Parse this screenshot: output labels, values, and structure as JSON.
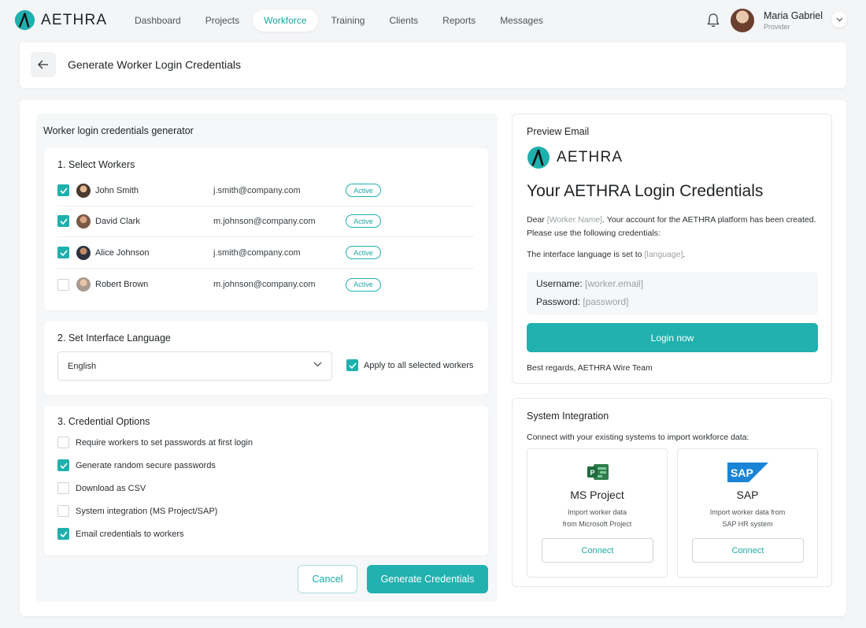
{
  "brand": {
    "name": "AETHRA"
  },
  "nav": {
    "items": [
      "Dashboard",
      "Projects",
      "Workforce",
      "Training",
      "Clients",
      "Reports",
      "Messages"
    ],
    "active": "Workforce"
  },
  "user": {
    "name": "Maria Gabriel",
    "role": "Provider"
  },
  "header": {
    "title": "Generate Worker Login Credentials"
  },
  "generator": {
    "title": "Worker login credentials generator",
    "workers_section": {
      "title": "1. Select Workers",
      "workers": [
        {
          "name": "John Smith",
          "email": "j.smith@company.com",
          "status": "Active",
          "checked": true
        },
        {
          "name": "David Clark",
          "email": "m.johnson@company.com",
          "status": "Active",
          "checked": true
        },
        {
          "name": "Alice Johnson",
          "email": "j.smith@company.com",
          "status": "Active",
          "checked": true
        },
        {
          "name": "Robert Brown",
          "email": "m.johnson@company.com",
          "status": "Active",
          "checked": false
        }
      ]
    },
    "language_section": {
      "title": "2. Set Interface Language",
      "selected": "English",
      "apply_label": "Apply to all selected workers",
      "apply_checked": true
    },
    "options_section": {
      "title": "3. Credential Options",
      "options": [
        {
          "label": "Require workers to set passwords at first login",
          "checked": false
        },
        {
          "label": "Generate random secure passwords",
          "checked": true
        },
        {
          "label": "Download as CSV",
          "checked": false
        },
        {
          "label": "System integration (MS Project/SAP)",
          "checked": false
        },
        {
          "label": "Email credentials to workers",
          "checked": true
        }
      ]
    },
    "cancel_label": "Cancel",
    "generate_label": "Generate Credentials"
  },
  "preview": {
    "title": "Preview Email",
    "logo_text": "AETHRA",
    "heading": "Your AETHRA Login Credentials",
    "dear": "Dear ",
    "worker_name_placeholder": "[Worker Name]",
    "body_after_name": ". Your account for the AETHRA platform has been created. Please use the following credentials:",
    "language_line": "The interface language is set to ",
    "language_placeholder": "[language]",
    "language_line_end": ".",
    "username_label": "Username:",
    "username_placeholder": "[worker.email]",
    "password_label": "Password:",
    "password_placeholder": "[password]",
    "login_button": "Login now",
    "regards": "Best regards, AETHRA Wire Team"
  },
  "integration": {
    "title": "System Integration",
    "description": "Connect with your existing systems to import workforce data:",
    "systems": [
      {
        "name": "MS Project",
        "desc_line1": "Import worker data",
        "desc_line2": "from Microsoft Project",
        "button": "Connect",
        "icon": "ms-project-icon"
      },
      {
        "name": "SAP",
        "desc_line1": "Import worker data from",
        "desc_line2": "SAP HR system",
        "button": "Connect",
        "icon": "sap-icon",
        "logo_text": "SAP"
      }
    ]
  },
  "colors": {
    "accent": "#21b1ae",
    "background": "#f4f5f6"
  }
}
